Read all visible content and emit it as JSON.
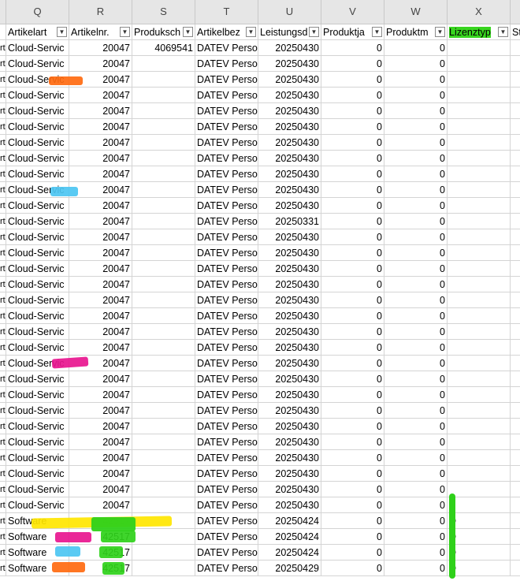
{
  "columns": [
    "Q",
    "R",
    "S",
    "T",
    "U",
    "V",
    "W",
    "X"
  ],
  "headers": {
    "p_tail": "",
    "q": "Artikelart",
    "r": "Artikelnr.",
    "s": "Produksch",
    "t": "Artikelbez",
    "u": "Leistungsd",
    "v": "Produktja",
    "w": "Produktm",
    "x": "Lizenztyp",
    "y": "St"
  },
  "rows": [
    {
      "p": "rt",
      "q": "Cloud-Servic",
      "r": "20047",
      "s": "4069541",
      "t": "DATEV Perso",
      "u": "20250430",
      "v": "0",
      "w": "0",
      "x": ""
    },
    {
      "p": "rt",
      "q": "Cloud-Servic",
      "r": "20047",
      "s": "",
      "t": "DATEV Perso",
      "u": "20250430",
      "v": "0",
      "w": "0",
      "x": ""
    },
    {
      "p": "rt",
      "q": "Cloud-Servic",
      "r": "20047",
      "s": "",
      "t": "DATEV Perso",
      "u": "20250430",
      "v": "0",
      "w": "0",
      "x": ""
    },
    {
      "p": "rt",
      "q": "Cloud-Servic",
      "r": "20047",
      "s": "",
      "t": "DATEV Perso",
      "u": "20250430",
      "v": "0",
      "w": "0",
      "x": ""
    },
    {
      "p": "rt",
      "q": "Cloud-Servic",
      "r": "20047",
      "s": "",
      "t": "DATEV Perso",
      "u": "20250430",
      "v": "0",
      "w": "0",
      "x": ""
    },
    {
      "p": "rt",
      "q": "Cloud-Servic",
      "r": "20047",
      "s": "",
      "t": "DATEV Perso",
      "u": "20250430",
      "v": "0",
      "w": "0",
      "x": ""
    },
    {
      "p": "rt",
      "q": "Cloud-Servic",
      "r": "20047",
      "s": "",
      "t": "DATEV Perso",
      "u": "20250430",
      "v": "0",
      "w": "0",
      "x": ""
    },
    {
      "p": "rt",
      "q": "Cloud-Servic",
      "r": "20047",
      "s": "",
      "t": "DATEV Perso",
      "u": "20250430",
      "v": "0",
      "w": "0",
      "x": ""
    },
    {
      "p": "rt",
      "q": "Cloud-Servic",
      "r": "20047",
      "s": "",
      "t": "DATEV Perso",
      "u": "20250430",
      "v": "0",
      "w": "0",
      "x": ""
    },
    {
      "p": "rt",
      "q": "Cloud-Servic",
      "r": "20047",
      "s": "",
      "t": "DATEV Perso",
      "u": "20250430",
      "v": "0",
      "w": "0",
      "x": ""
    },
    {
      "p": "rt",
      "q": "Cloud-Servic",
      "r": "20047",
      "s": "",
      "t": "DATEV Perso",
      "u": "20250430",
      "v": "0",
      "w": "0",
      "x": ""
    },
    {
      "p": "rt",
      "q": "Cloud-Servic",
      "r": "20047",
      "s": "",
      "t": "DATEV Perso",
      "u": "20250331",
      "v": "0",
      "w": "0",
      "x": ""
    },
    {
      "p": "rt",
      "q": "Cloud-Servic",
      "r": "20047",
      "s": "",
      "t": "DATEV Perso",
      "u": "20250430",
      "v": "0",
      "w": "0",
      "x": ""
    },
    {
      "p": "rt",
      "q": "Cloud-Servic",
      "r": "20047",
      "s": "",
      "t": "DATEV Perso",
      "u": "20250430",
      "v": "0",
      "w": "0",
      "x": ""
    },
    {
      "p": "rt",
      "q": "Cloud-Servic",
      "r": "20047",
      "s": "",
      "t": "DATEV Perso",
      "u": "20250430",
      "v": "0",
      "w": "0",
      "x": ""
    },
    {
      "p": "rt",
      "q": "Cloud-Servic",
      "r": "20047",
      "s": "",
      "t": "DATEV Perso",
      "u": "20250430",
      "v": "0",
      "w": "0",
      "x": ""
    },
    {
      "p": "rt",
      "q": "Cloud-Servic",
      "r": "20047",
      "s": "",
      "t": "DATEV Perso",
      "u": "20250430",
      "v": "0",
      "w": "0",
      "x": ""
    },
    {
      "p": "rt",
      "q": "Cloud-Servic",
      "r": "20047",
      "s": "",
      "t": "DATEV Perso",
      "u": "20250430",
      "v": "0",
      "w": "0",
      "x": ""
    },
    {
      "p": "rt",
      "q": "Cloud-Servic",
      "r": "20047",
      "s": "",
      "t": "DATEV Perso",
      "u": "20250430",
      "v": "0",
      "w": "0",
      "x": ""
    },
    {
      "p": "rt",
      "q": "Cloud-Servic",
      "r": "20047",
      "s": "",
      "t": "DATEV Perso",
      "u": "20250430",
      "v": "0",
      "w": "0",
      "x": ""
    },
    {
      "p": "rt",
      "q": "Cloud-Servic",
      "r": "20047",
      "s": "",
      "t": "DATEV Perso",
      "u": "20250430",
      "v": "0",
      "w": "0",
      "x": ""
    },
    {
      "p": "rt",
      "q": "Cloud-Servic",
      "r": "20047",
      "s": "",
      "t": "DATEV Perso",
      "u": "20250430",
      "v": "0",
      "w": "0",
      "x": ""
    },
    {
      "p": "rt",
      "q": "Cloud-Servic",
      "r": "20047",
      "s": "",
      "t": "DATEV Perso",
      "u": "20250430",
      "v": "0",
      "w": "0",
      "x": ""
    },
    {
      "p": "rt",
      "q": "Cloud-Servic",
      "r": "20047",
      "s": "",
      "t": "DATEV Perso",
      "u": "20250430",
      "v": "0",
      "w": "0",
      "x": ""
    },
    {
      "p": "rt",
      "q": "Cloud-Servic",
      "r": "20047",
      "s": "",
      "t": "DATEV Perso",
      "u": "20250430",
      "v": "0",
      "w": "0",
      "x": ""
    },
    {
      "p": "rt",
      "q": "Cloud-Servic",
      "r": "20047",
      "s": "",
      "t": "DATEV Perso",
      "u": "20250430",
      "v": "0",
      "w": "0",
      "x": ""
    },
    {
      "p": "rt",
      "q": "Cloud-Servic",
      "r": "20047",
      "s": "",
      "t": "DATEV Perso",
      "u": "20250430",
      "v": "0",
      "w": "0",
      "x": ""
    },
    {
      "p": "rt",
      "q": "Cloud-Servic",
      "r": "20047",
      "s": "",
      "t": "DATEV Perso",
      "u": "20250430",
      "v": "0",
      "w": "0",
      "x": ""
    },
    {
      "p": "rt",
      "q": "Cloud-Servic",
      "r": "20047",
      "s": "",
      "t": "DATEV Perso",
      "u": "20250430",
      "v": "0",
      "w": "0",
      "x": ""
    },
    {
      "p": "rt",
      "q": "Cloud-Servic",
      "r": "20047",
      "s": "",
      "t": "DATEV Perso",
      "u": "20250430",
      "v": "0",
      "w": "0",
      "x": ""
    },
    {
      "p": "rt",
      "q": "Software",
      "r": "42517",
      "s": "",
      "t": "DATEV Perso",
      "u": "20250424",
      "v": "0",
      "w": "0",
      "x": "D"
    },
    {
      "p": "rt",
      "q": "Software",
      "r": "42517",
      "s": "",
      "t": "DATEV Perso",
      "u": "20250424",
      "v": "0",
      "w": "0",
      "x": "D"
    },
    {
      "p": "rt",
      "q": "Software",
      "r": "42517",
      "s": "",
      "t": "DATEV Perso",
      "u": "20250424",
      "v": "0",
      "w": "0",
      "x": "D"
    },
    {
      "p": "rt",
      "q": "Software",
      "r": "42517",
      "s": "",
      "t": "DATEV Perso",
      "u": "20250429",
      "v": "0",
      "w": "0",
      "x": "D"
    }
  ],
  "colors": {
    "orange": "#ff6a10",
    "cyan": "#4cc6f2",
    "magenta": "#e8168f",
    "yellow": "#ffe600",
    "green": "#2fd11a",
    "header_bg": "#e6e6e6",
    "gridline": "#d4d4d4"
  }
}
